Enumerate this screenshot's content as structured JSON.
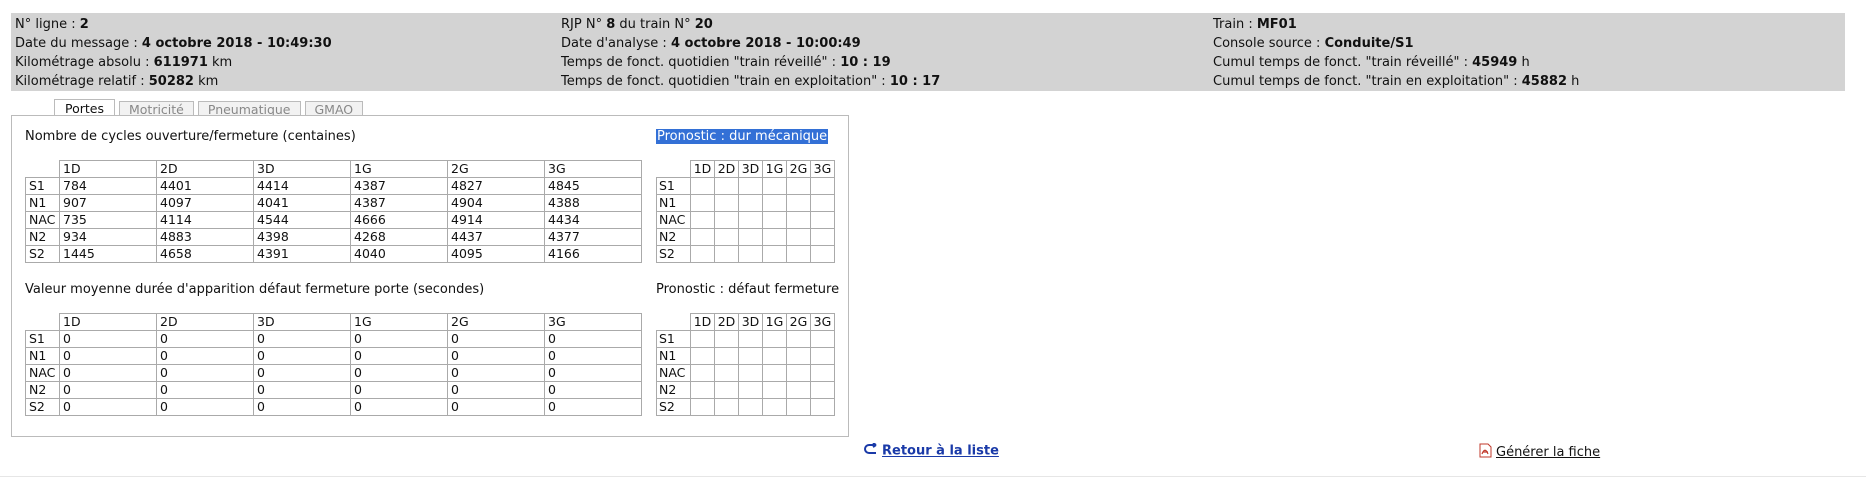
{
  "header": {
    "col1": [
      {
        "label": "N° ligne : ",
        "value": "2",
        "suffix": ""
      },
      {
        "label": "Date du message : ",
        "value": "4 octobre 2018 - 10:49:30",
        "suffix": ""
      },
      {
        "label": "Kilométrage absolu : ",
        "value": "611971",
        "suffix": " km"
      },
      {
        "label": "Kilométrage relatif : ",
        "value": "50282",
        "suffix": " km"
      }
    ],
    "col2_line1": {
      "p1": "RJP N° ",
      "v1": "8",
      "p2": " du train N° ",
      "v2": "20"
    },
    "col2": [
      {
        "label": "Date d'analyse : ",
        "value": "4 octobre 2018 - 10:00:49",
        "suffix": ""
      },
      {
        "label": "Temps de fonct. quotidien \"train réveillé\" : ",
        "value": "10 : 19",
        "suffix": ""
      },
      {
        "label": "Temps de fonct. quotidien \"train en exploitation\" : ",
        "value": "10 : 17",
        "suffix": ""
      }
    ],
    "col3": [
      {
        "label": "Train : ",
        "value": "MF01",
        "suffix": ""
      },
      {
        "label": "Console source : ",
        "value": "Conduite/S1",
        "suffix": ""
      },
      {
        "label": "Cumul temps de fonct. \"train réveillé\" : ",
        "value": "45949",
        "suffix": " h"
      },
      {
        "label": "Cumul temps de fonct. \"train en exploitation\" : ",
        "value": "45882",
        "suffix": " h"
      }
    ]
  },
  "tabs": [
    {
      "label": "Portes",
      "active": true
    },
    {
      "label": "Motricité",
      "active": false
    },
    {
      "label": "Pneumatique",
      "active": false
    },
    {
      "label": "GMAO",
      "active": false
    }
  ],
  "cycles": {
    "title": "Nombre de cycles ouverture/fermeture (centaines)",
    "columns": [
      "1D",
      "2D",
      "3D",
      "1G",
      "2G",
      "3G"
    ],
    "rows": [
      {
        "label": "S1",
        "values": [
          "784",
          "4401",
          "4414",
          "4387",
          "4827",
          "4845"
        ]
      },
      {
        "label": "N1",
        "values": [
          "907",
          "4097",
          "4041",
          "4387",
          "4904",
          "4388"
        ]
      },
      {
        "label": "NAC",
        "values": [
          "735",
          "4114",
          "4544",
          "4666",
          "4914",
          "4434"
        ]
      },
      {
        "label": "N2",
        "values": [
          "934",
          "4883",
          "4398",
          "4268",
          "4437",
          "4377"
        ]
      },
      {
        "label": "S2",
        "values": [
          "1445",
          "4658",
          "4391",
          "4040",
          "4095",
          "4166"
        ]
      }
    ]
  },
  "prognostic1": {
    "title": "Pronostic : dur mécanique",
    "columns": [
      "1D",
      "2D",
      "3D",
      "1G",
      "2G",
      "3G"
    ],
    "rows": [
      "S1",
      "N1",
      "NAC",
      "N2",
      "S2"
    ]
  },
  "duration": {
    "title": "Valeur moyenne durée d'apparition défaut fermeture porte (secondes)",
    "columns": [
      "1D",
      "2D",
      "3D",
      "1G",
      "2G",
      "3G"
    ],
    "rows": [
      {
        "label": "S1",
        "values": [
          "0",
          "0",
          "0",
          "0",
          "0",
          "0"
        ]
      },
      {
        "label": "N1",
        "values": [
          "0",
          "0",
          "0",
          "0",
          "0",
          "0"
        ]
      },
      {
        "label": "NAC",
        "values": [
          "0",
          "0",
          "0",
          "0",
          "0",
          "0"
        ]
      },
      {
        "label": "N2",
        "values": [
          "0",
          "0",
          "0",
          "0",
          "0",
          "0"
        ]
      },
      {
        "label": "S2",
        "values": [
          "0",
          "0",
          "0",
          "0",
          "0",
          "0"
        ]
      }
    ]
  },
  "prognostic2": {
    "title": "Pronostic : défaut fermeture",
    "columns": [
      "1D",
      "2D",
      "3D",
      "1G",
      "2G",
      "3G"
    ],
    "rows": [
      "S1",
      "N1",
      "NAC",
      "N2",
      "S2"
    ]
  },
  "footer": {
    "back_label": "Retour à la liste",
    "back_icon": "return-arrow-icon",
    "generate_label": "Générer la fiche",
    "generate_icon": "pdf-icon"
  },
  "colors": {
    "header_bg": "#d3d3d3",
    "highlight": "#3370d6",
    "link": "#1a3aa8"
  }
}
